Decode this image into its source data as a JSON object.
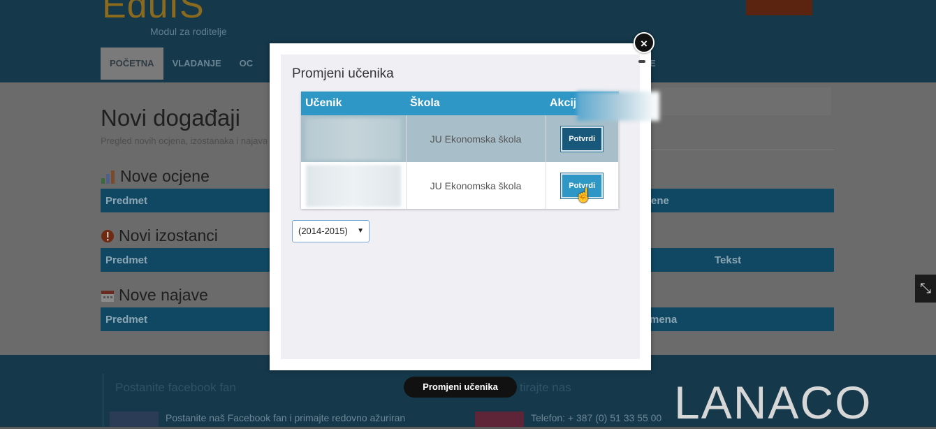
{
  "header": {
    "logo_text": "EduIS",
    "logo_subtitle": "Modul za roditelje",
    "nav": [
      {
        "label": "POČETNA"
      },
      {
        "label": "VLADANJE"
      },
      {
        "label": "OC"
      }
    ],
    "nav_right_fragment": "E"
  },
  "main": {
    "title": "Novi događaji",
    "subtitle": "Pregled novih ocjena, izostanaka i najava",
    "sections": [
      {
        "title": "Nove ocjene",
        "col1": "Predmet",
        "col_right": "ene"
      },
      {
        "title": "Novi izostanci",
        "col1": "Predmet",
        "col_right": "Tekst"
      },
      {
        "title": "Nove najave",
        "col1": "Predmet",
        "col_right": "mena"
      }
    ]
  },
  "modal": {
    "title": "Promjeni učenika",
    "close_symbol": "×",
    "table": {
      "headers": [
        "Učenik",
        "Škola",
        "Akcij"
      ],
      "rows": [
        {
          "student": "",
          "school": "JU Ekonomska škola",
          "action": "Potvrdi"
        },
        {
          "student": "",
          "school": "JU Ekonomska škola",
          "action": "Potvrdi"
        }
      ]
    },
    "year_select": {
      "value": "(2014-2015)",
      "arrow": "▼"
    }
  },
  "tooltip": "Promjeni učenika",
  "footer": {
    "facebook_heading": "Postanite facebook fan",
    "contact_heading": "tirajte nas",
    "facebook_text": "Postanite naš Facebook fan i primajte redovno ažuriran",
    "phone_text": "Telefon: + 387 (0) 51 33 55 00"
  },
  "watermark": "LANACO",
  "colors": {
    "accent_blue": "#2f97c6",
    "dark_blue": "#15384b",
    "selected_row": "#a8bfc9"
  }
}
